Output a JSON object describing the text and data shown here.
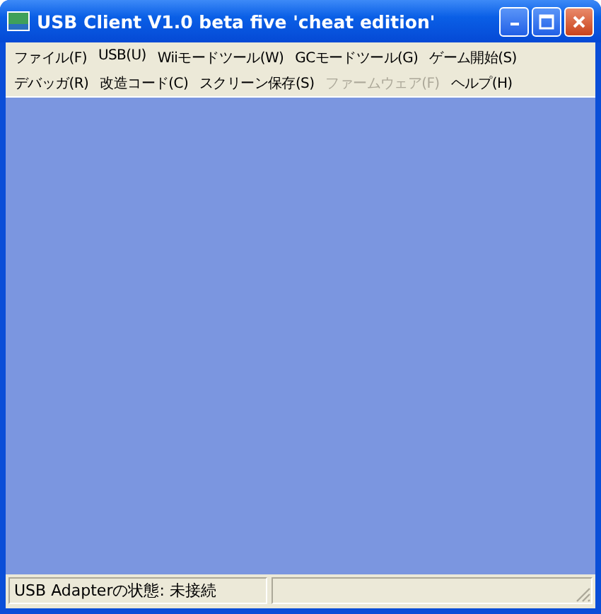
{
  "window": {
    "title": "USB Client V1.0 beta five 'cheat edition'"
  },
  "menu": [
    {
      "label": "ファイル(F)",
      "disabled": false
    },
    {
      "label": "USB(U)",
      "disabled": false
    },
    {
      "label": "Wiiモードツール(W)",
      "disabled": false
    },
    {
      "label": "GCモードツール(G)",
      "disabled": false
    },
    {
      "label": "ゲーム開始(S)",
      "disabled": false
    },
    {
      "label": "デバッガ(R)",
      "disabled": false
    },
    {
      "label": "改造コード(C)",
      "disabled": false
    },
    {
      "label": "スクリーン保存(S)",
      "disabled": false
    },
    {
      "label": "ファームウェア(F)",
      "disabled": true
    },
    {
      "label": "ヘルプ(H)",
      "disabled": false
    }
  ],
  "status_bar": {
    "panels": [
      "USB Adapterの状態: 未接続"
    ]
  }
}
